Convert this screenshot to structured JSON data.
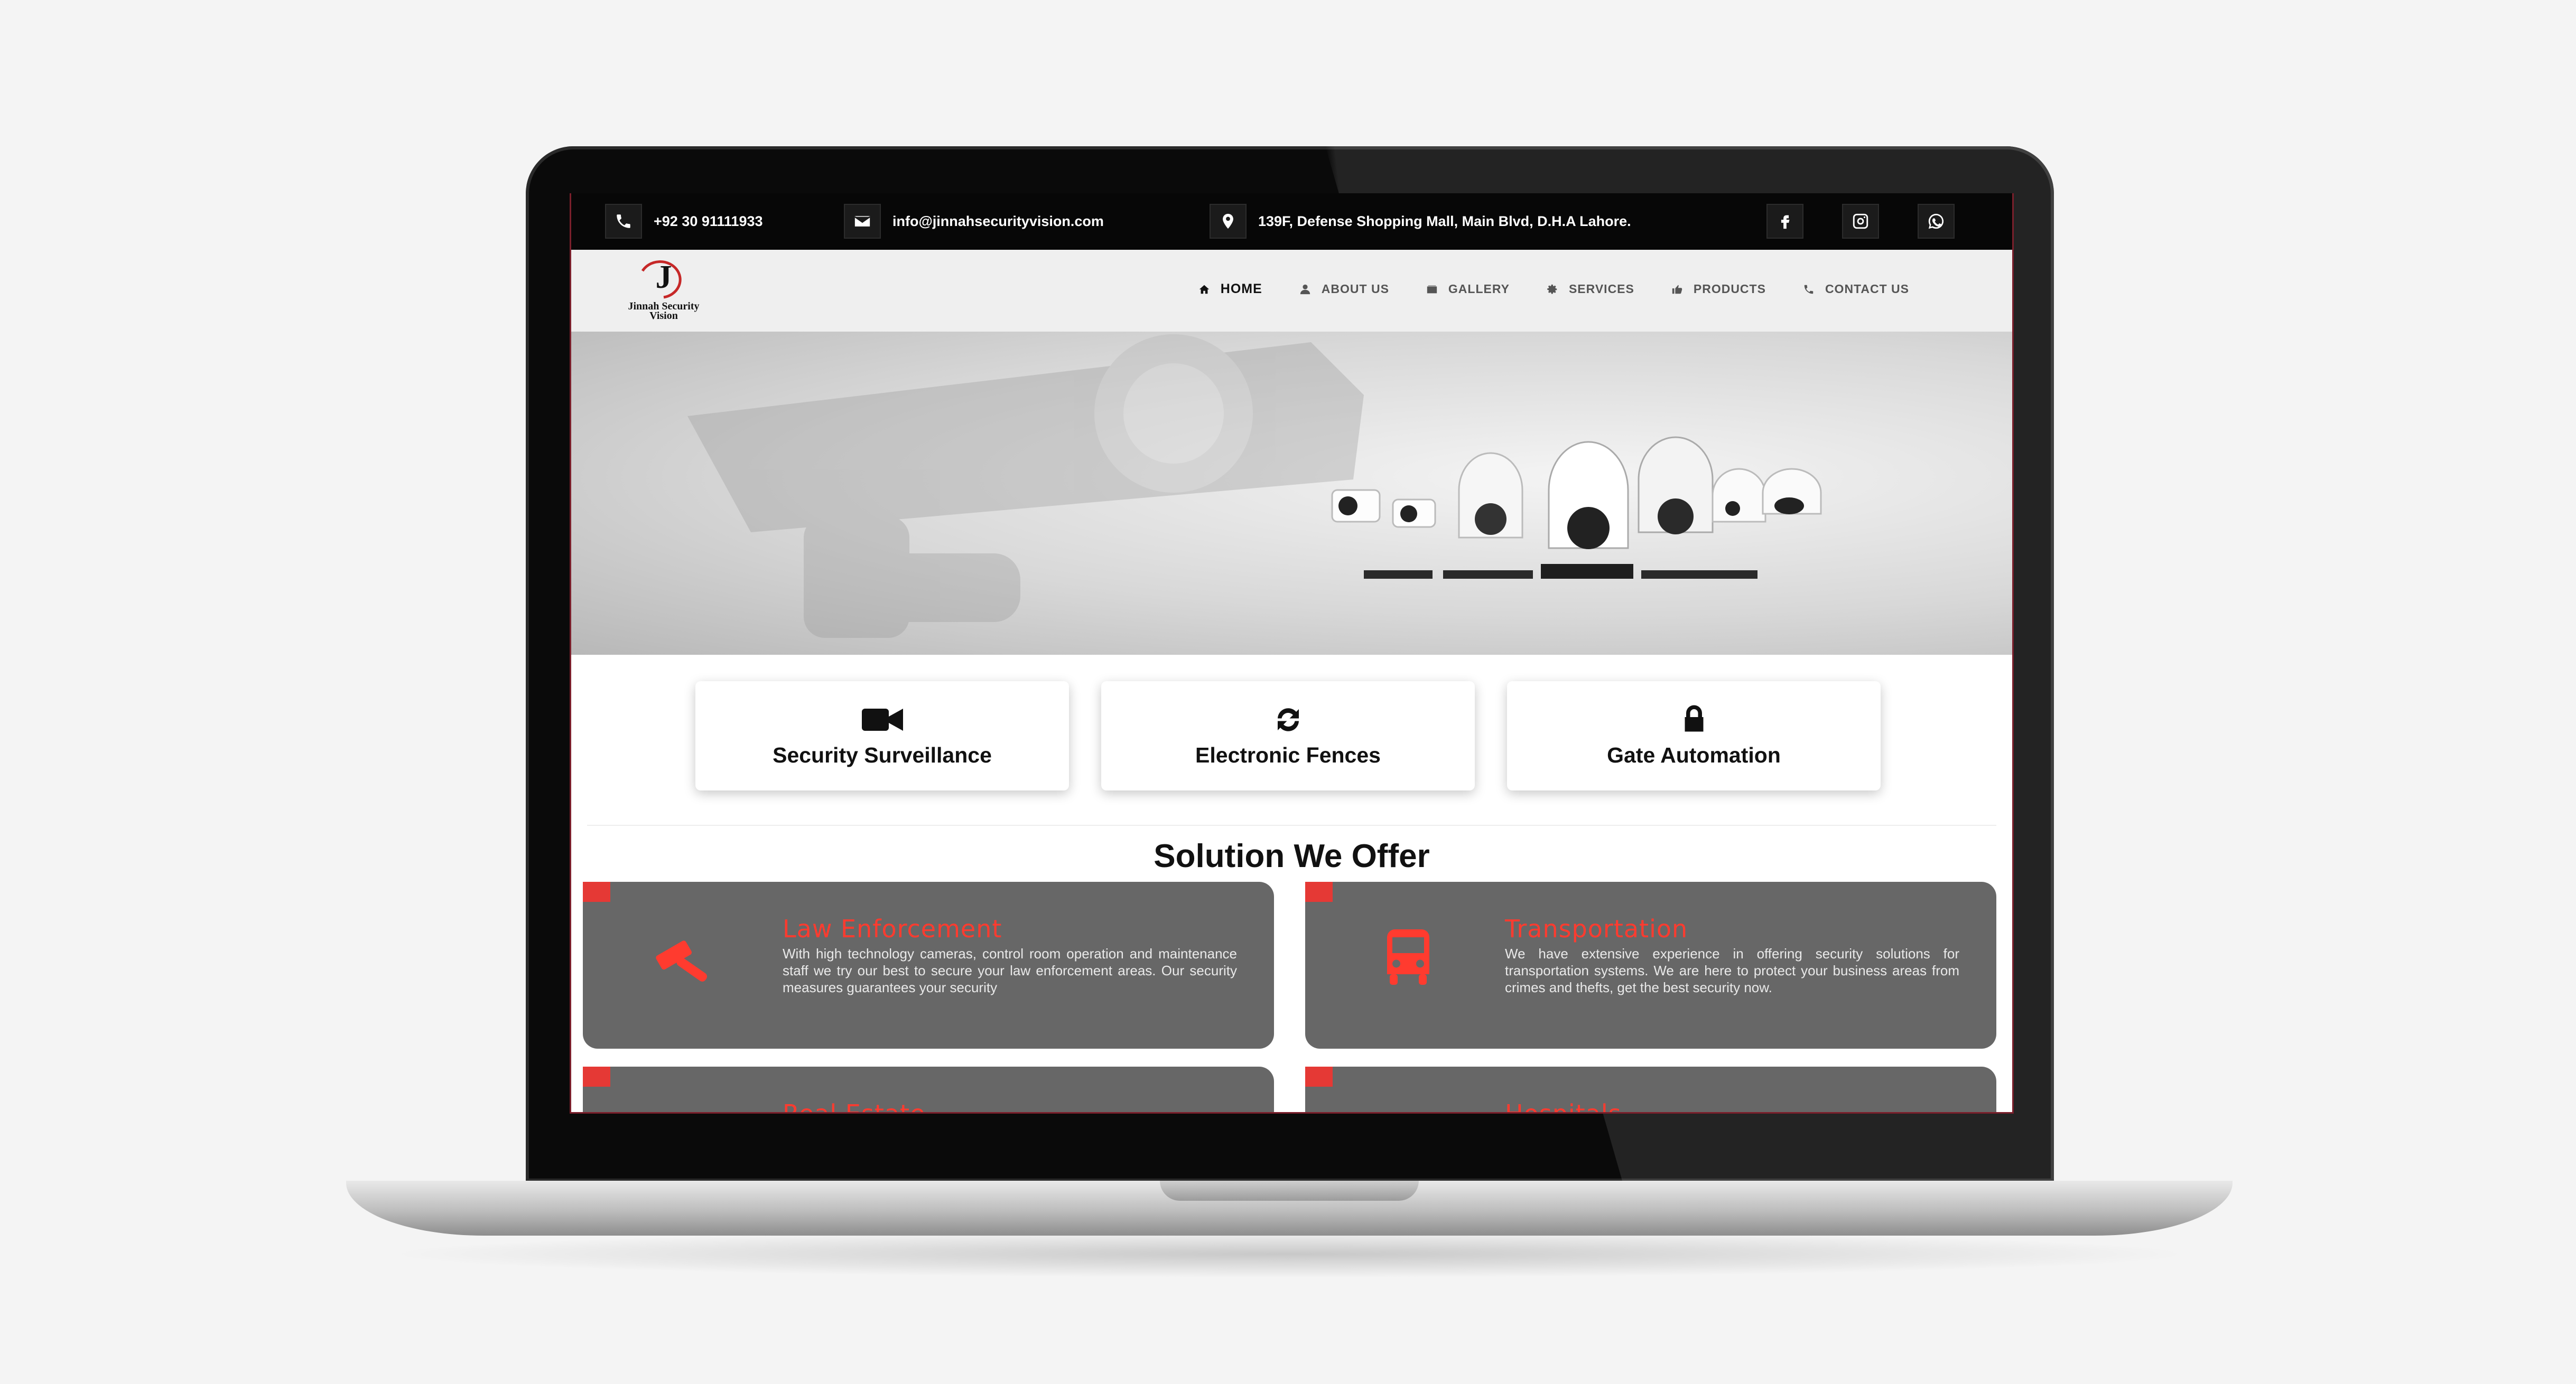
{
  "topbar": {
    "phone": "+92 30 91111933",
    "email": "info@jinnahsecurityvision.com",
    "address": "139F, Defense Shopping Mall, Main Blvd, D.H.A Lahore.",
    "social": [
      "facebook-icon",
      "instagram-icon",
      "whatsapp-icon"
    ]
  },
  "logo": {
    "line1": "Jinnah Security",
    "line2": "Vision",
    "mark": "J"
  },
  "nav": [
    {
      "label": "HOME",
      "icon": "home-icon",
      "active": true
    },
    {
      "label": "ABOUT US",
      "icon": "user-icon"
    },
    {
      "label": "GALLERY",
      "icon": "gallery-icon"
    },
    {
      "label": "SERVICES",
      "icon": "gear-icon"
    },
    {
      "label": "PRODUCTS",
      "icon": "thumbs-up-icon"
    },
    {
      "label": "CONTACT US",
      "icon": "phone-icon"
    }
  ],
  "tiles": [
    {
      "label": "Security Surveillance",
      "icon": "video-camera-icon"
    },
    {
      "label": "Electronic Fences",
      "icon": "refresh-icon"
    },
    {
      "label": "Gate Automation",
      "icon": "lock-icon"
    }
  ],
  "section": {
    "title": "Solution We Offer"
  },
  "solutions": [
    {
      "title": "Law Enforcement",
      "icon": "gavel-icon",
      "text": "With high technology cameras, control room operation and maintenance staff we try our best to secure your law enforcement areas. Our security measures guarantees your security"
    },
    {
      "title": "Transportation",
      "icon": "bus-icon",
      "text": "We have extensive experience in offering security solutions for transportation systems. We are here to protect your business areas from crimes and thefts, get the best security now."
    },
    {
      "title": "Real Estate",
      "icon": "building-icon",
      "text": ""
    },
    {
      "title": "Hospitals",
      "icon": "hospital-icon",
      "text": ""
    }
  ],
  "colors": {
    "accent": "#ff3b2f",
    "card": "#676767",
    "topbar": "#070707",
    "nav": "#efefef"
  }
}
